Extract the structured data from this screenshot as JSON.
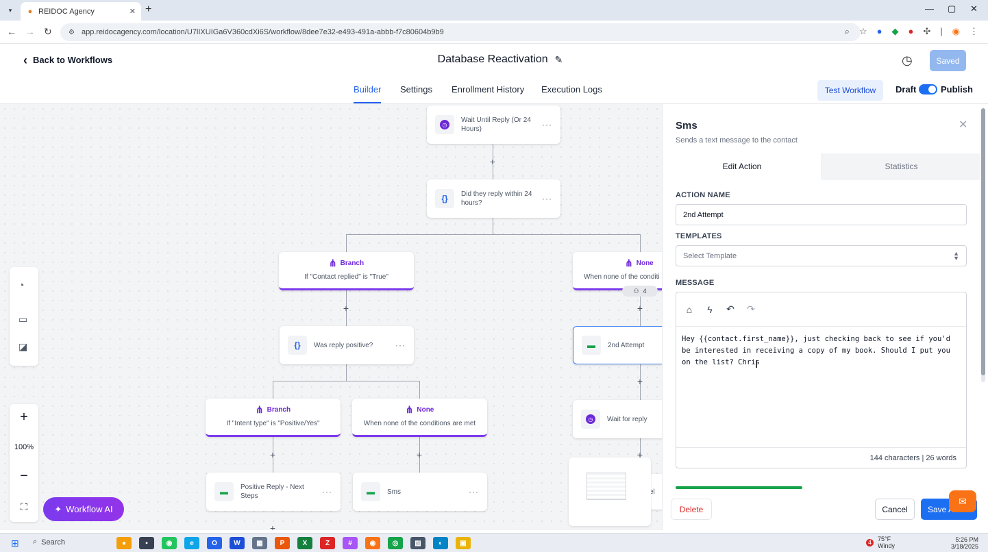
{
  "browser": {
    "tab_title": "REIDOC Agency",
    "url": "app.reidocagency.com/location/U7lIXUIGa6V360cdXi6S/workflow/8dee7e32-e493-491a-abbb-f7c80604b9b9",
    "new_tab": "+",
    "win_min": "—",
    "win_max": "▢",
    "win_close": "✕"
  },
  "header": {
    "back_label": "Back to Workflows",
    "title": "Database Reactivation",
    "saved_label": "Saved"
  },
  "subnav": {
    "tabs": [
      {
        "label": "Builder"
      },
      {
        "label": "Settings"
      },
      {
        "label": "Enrollment History"
      },
      {
        "label": "Execution Logs"
      }
    ],
    "test_label": "Test Workflow",
    "draft_label": "Draft",
    "publish_label": "Publish"
  },
  "canvas": {
    "nodes": {
      "wait_until": "Wait Until Reply (Or 24 Hours)",
      "did_reply": "Did they reply within 24 hours?",
      "was_positive": "Was reply positive?",
      "second_attempt": "2nd Attempt",
      "wait_reply": "Wait for reply",
      "positive_reply": "Positive Reply - Next Steps",
      "sms": "Sms",
      "cut_label": "el"
    },
    "branches": {
      "b1_head": "Branch",
      "b1_desc": "If \"Contact replied\" is \"True\"",
      "b2_head": "None",
      "b2_desc": "When none of the conditi",
      "b3_head": "Branch",
      "b3_desc": "If \"Intent type\" is \"Positive/Yes\"",
      "b4_head": "None",
      "b4_desc": "When none of the conditions are met"
    },
    "badge_count": "4",
    "zoom_level": "100%",
    "workflow_ai_label": "Workflow AI"
  },
  "panel": {
    "title": "Sms",
    "subtitle": "Sends a text message to the contact",
    "tab_edit": "Edit Action",
    "tab_stats": "Statistics",
    "action_name_label": "ACTION NAME",
    "action_name_value": "2nd Attempt",
    "templates_label": "TEMPLATES",
    "templates_placeholder": "Select Template",
    "message_label": "MESSAGE",
    "message_text": "Hey {{contact.first_name}}, just checking back to see if you'd be interested in receiving a copy of my book. Should I put you on the list? Chris",
    "message_count": "144 characters | 26 words",
    "delete_label": "Delete",
    "cancel_label": "Cancel",
    "save_label": "Save A"
  },
  "taskbar": {
    "search_label": "Search",
    "weather_temp": "75°F",
    "weather_desc": "Windy",
    "weather_badge": "4",
    "time": "5:26 PM",
    "date": "3/18/2025"
  },
  "colors": {
    "accent": "#2563eb",
    "branch_purple": "#7c3aed",
    "delete_red": "#dc2626",
    "save_blue": "#1d6ff2"
  }
}
